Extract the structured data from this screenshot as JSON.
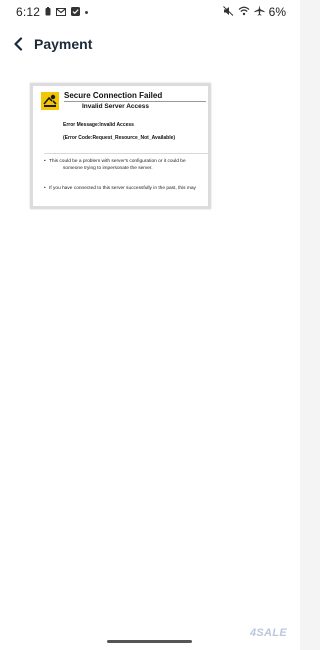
{
  "status_bar": {
    "time": "6:12",
    "battery": "6%",
    "left_icons": [
      "battery-saver-icon",
      "gmail-icon",
      "checkbox-icon"
    ],
    "right_icons": [
      "mute-icon",
      "wifi-icon",
      "airplane-icon"
    ]
  },
  "app_bar": {
    "title": "Payment"
  },
  "error_card": {
    "title": "Secure Connection Failed",
    "subtitle": "Invalid Server Access",
    "error_message": "Error Message:Invalid Access",
    "error_code": "(Error Code:Request_Resource_Not_Available)",
    "bullets": [
      {
        "line1": "This could be a problem with server's configuration or it could be",
        "line2": "someone trying to impersonate the server."
      },
      {
        "line1": "If you have connected to this server successfully in the past, this may"
      }
    ]
  },
  "watermark": "4SALE"
}
